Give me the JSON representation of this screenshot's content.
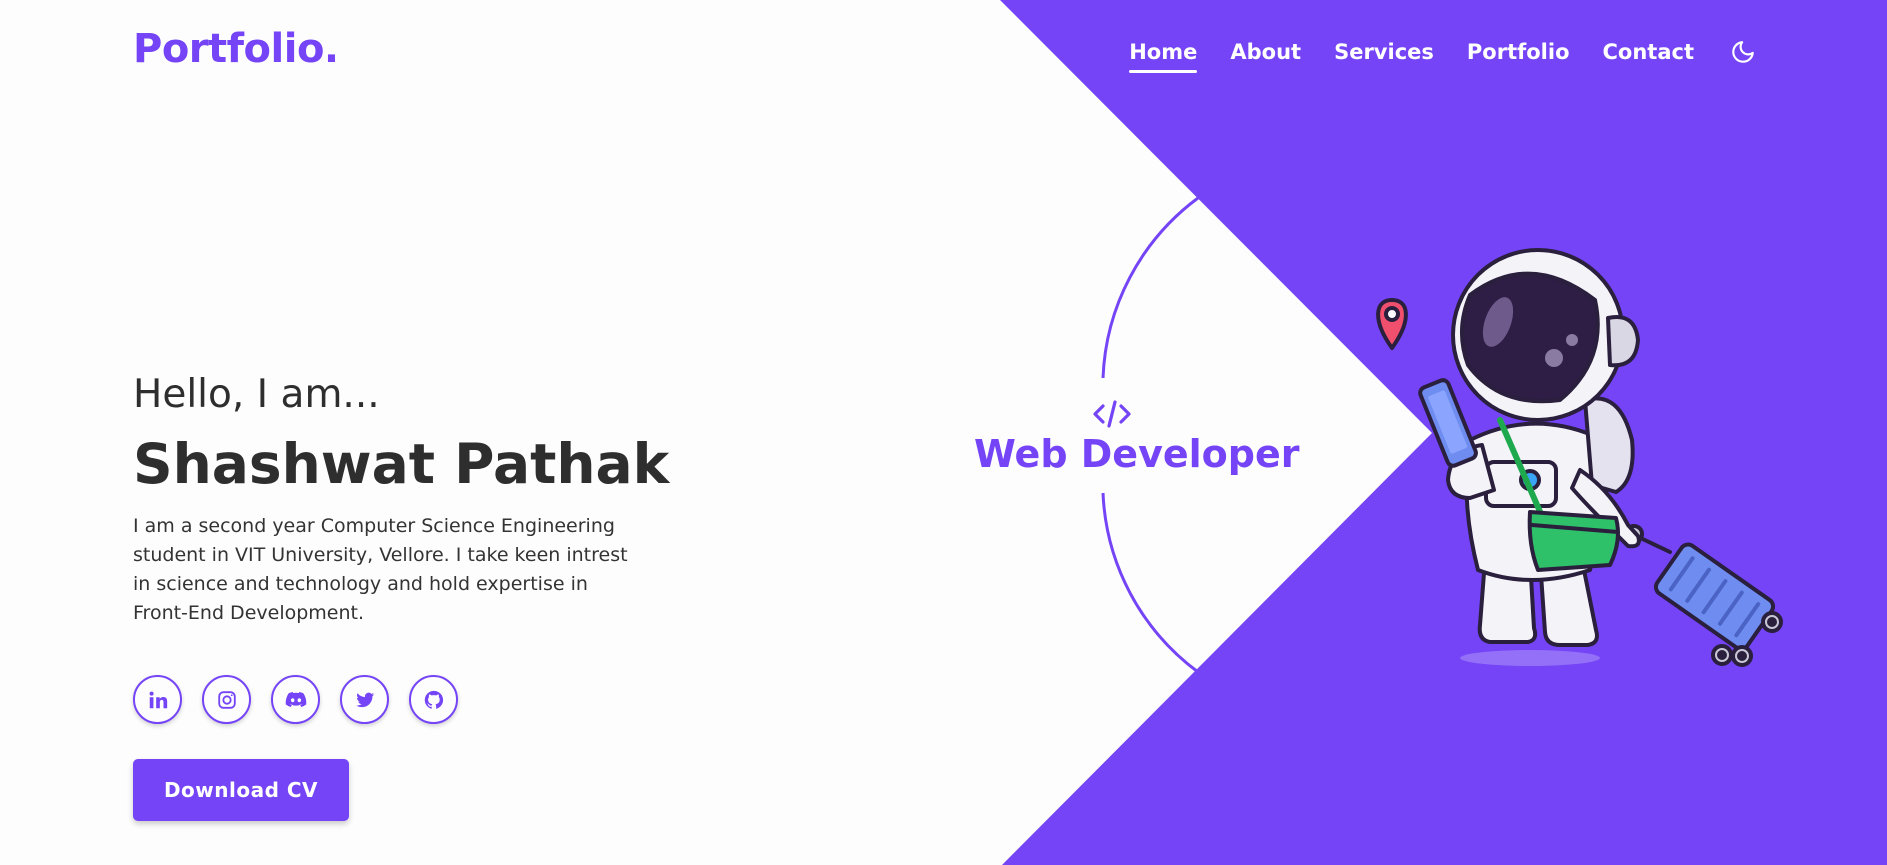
{
  "header": {
    "logo": "Portfolio.",
    "nav": [
      {
        "label": "Home",
        "active": true
      },
      {
        "label": "About",
        "active": false
      },
      {
        "label": "Services",
        "active": false
      },
      {
        "label": "Portfolio",
        "active": false
      },
      {
        "label": "Contact",
        "active": false
      }
    ],
    "theme_toggle_icon": "moon-icon"
  },
  "hero": {
    "greeting": "Hello, I am...",
    "name": "Shashwat Pathak",
    "intro": "I am a second year Computer Science Engineering student in VIT University, Vellore. I take keen intrest in science and technology and hold expertise in Front-End Development.",
    "socials": [
      {
        "icon": "linkedin-icon"
      },
      {
        "icon": "instagram-icon"
      },
      {
        "icon": "discord-icon"
      },
      {
        "icon": "twitter-icon"
      },
      {
        "icon": "github-icon"
      }
    ],
    "download_label": "Download CV",
    "role_icon": "code-icon",
    "role": "Web Developer",
    "illustration": "astronaut-illustration"
  },
  "colors": {
    "accent": "#7444f6",
    "background": "#fdfdfd",
    "text": "#2e2e2e"
  }
}
